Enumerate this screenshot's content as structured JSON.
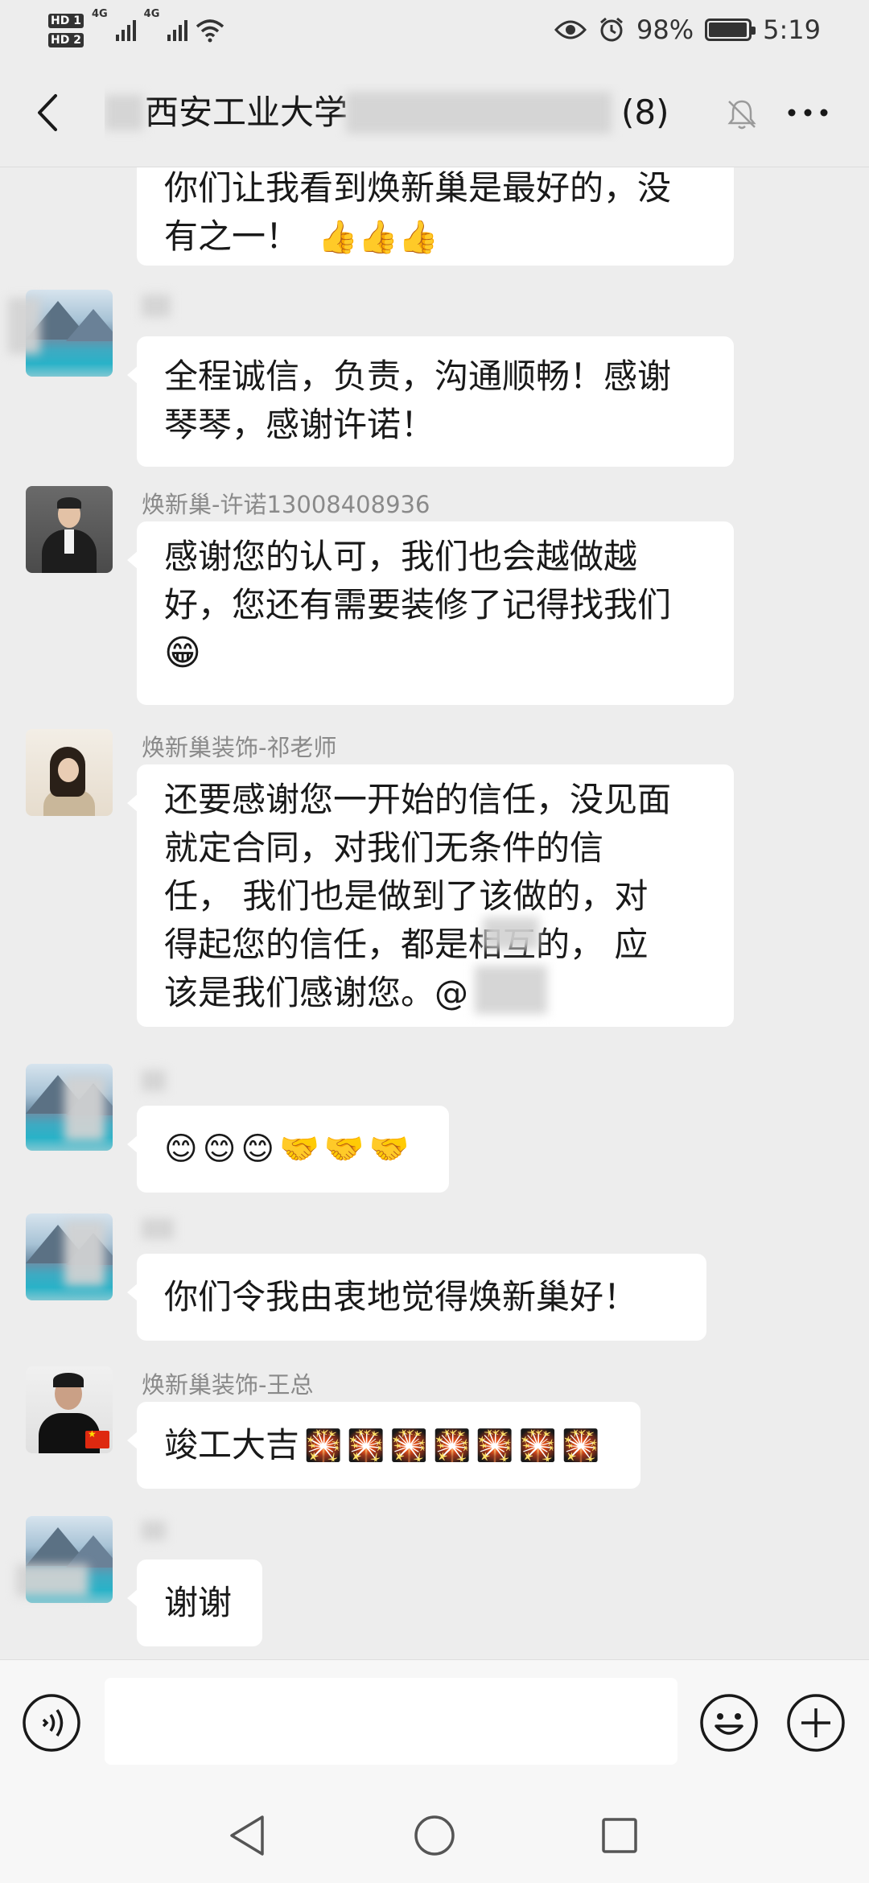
{
  "status_bar": {
    "hd1": "HD 1",
    "hd2": "HD 2",
    "net1": "4G",
    "net2": "4G",
    "battery_text": "98%",
    "battery_level": 0.98,
    "time": "5:19",
    "icons": [
      "signal-icon",
      "wifi-icon",
      "eye-icon",
      "alarm-icon",
      "battery-icon"
    ]
  },
  "header": {
    "title": "西安工业大学",
    "title_tail": "(8)",
    "icons": [
      "back-arrow-icon",
      "mute-bell-icon",
      "more-dots-icon"
    ]
  },
  "messages": [
    {
      "sender": "",
      "avatar": "lake-avatar",
      "lines": [
        "你们让我看到焕新巢是最好的，没",
        "有之一！"
      ],
      "emoji": [
        "thumbs-up-icon",
        "thumbs-up-icon",
        "thumbs-up-icon"
      ]
    },
    {
      "sender": "",
      "avatar": "lake-avatar",
      "lines": [
        "全程诚信，负责，沟通顺畅！感谢",
        "琴琴，感谢许诺！"
      ]
    },
    {
      "sender": "焕新巢-许诺13008408936",
      "avatar": "suit-man-avatar",
      "lines": [
        "感谢您的认可，我们也会越做越",
        "好，您还有需要装修了记得找我们"
      ],
      "emoji": [
        "grinning-face-icon"
      ]
    },
    {
      "sender": "焕新巢装饰-祁老师",
      "avatar": "woman-avatar",
      "lines": [
        "还要感谢您一开始的信任，没见面",
        "就定合同，对我们无条件的信",
        "任，  我们也是做到了该做的，对",
        "得起您的信任，都是相互的，  应",
        "该是我们感谢您。@"
      ]
    },
    {
      "sender": "",
      "avatar": "lake-avatar",
      "emoji": [
        "smiling-face-icon",
        "smiling-face-icon",
        "smiling-face-icon",
        "handshake-icon",
        "handshake-icon",
        "handshake-icon"
      ]
    },
    {
      "sender": "",
      "avatar": "lake-avatar",
      "lines": [
        "你们令我由衷地觉得焕新巢好！"
      ]
    },
    {
      "sender": "焕新巢装饰-王总",
      "avatar": "man-flag-avatar",
      "lines": [
        "竣工大吉"
      ],
      "emoji": [
        "firework-icon",
        "firework-icon",
        "firework-icon",
        "firework-icon",
        "firework-icon",
        "firework-icon",
        "firework-icon"
      ]
    },
    {
      "sender": "",
      "avatar": "lake-avatar",
      "lines": [
        "谢谢"
      ]
    }
  ],
  "input_bar": {
    "placeholder": "",
    "icons": [
      "voice-icon",
      "emoji-icon",
      "plus-icon"
    ]
  },
  "nav_bar": {
    "icons": [
      "nav-back-icon",
      "nav-home-icon",
      "nav-recents-icon"
    ]
  },
  "colors": {
    "background": "#ededed",
    "bubble": "#ffffff",
    "text": "#191919",
    "sender_name": "#8a8a8a",
    "input_bar": "#f7f7f7"
  }
}
